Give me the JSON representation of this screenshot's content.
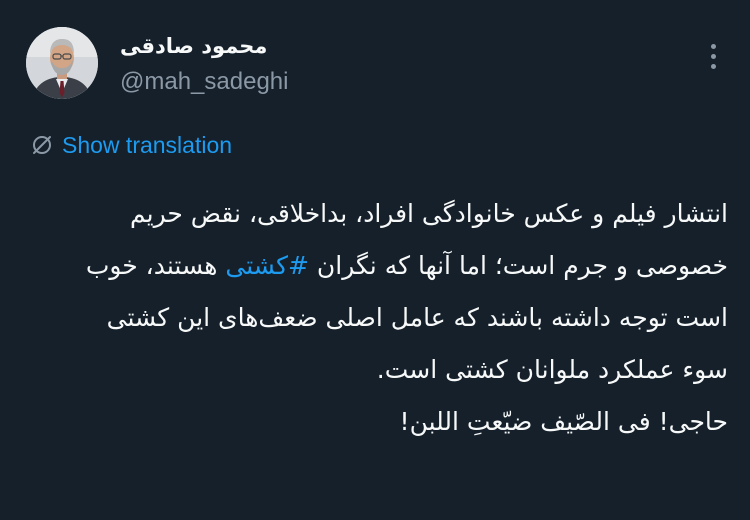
{
  "author": {
    "name": "محمود صادقی",
    "handle": "@mah_sadeghi"
  },
  "icons": {
    "more": "more-vertical-icon",
    "translate": "globe-slash-icon"
  },
  "colors": {
    "background": "#15202b",
    "text": "#f7f9f9",
    "secondary_text": "#8b98a5",
    "accent": "#1d9bf0"
  },
  "translation": {
    "label": "Show translation"
  },
  "tweet": {
    "line1": "انتشار فیلم و عکس خانوادگی افراد، بداخلاقی، نقض حریم",
    "line2_before": "خصوصی و جرم است؛ اما آنها که نگران ",
    "hashtag": "#کشتی",
    "line2_after": " هستند، خوب",
    "line3": "است توجه داشته باشند که عامل اصلی ضعف‌های این کشتی",
    "line4": "سوء عملکرد ملوانان کشتی است.",
    "line5": "حاجی!  فی الصّیف ضیّعتِ اللبن!"
  }
}
